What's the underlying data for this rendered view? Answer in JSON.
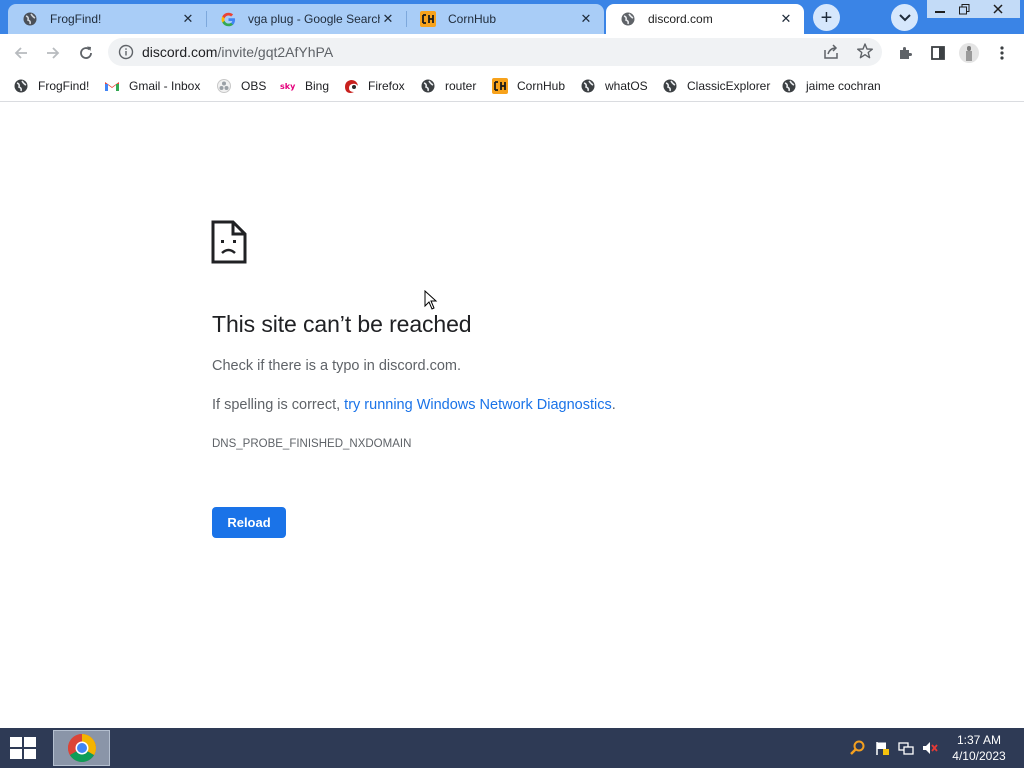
{
  "tabs": [
    {
      "title": "FrogFind!",
      "icon": "globe-icon",
      "active": false
    },
    {
      "title": "vga plug - Google Search",
      "icon": "google-icon",
      "active": false
    },
    {
      "title": "CornHub",
      "icon": "ch-icon",
      "active": false
    },
    {
      "title": "discord.com",
      "icon": "globe-icon",
      "active": true
    }
  ],
  "tab_close_glyph": "✕",
  "new_tab_glyph": "+",
  "address_bar": {
    "host": "discord.com",
    "path": "/invite/gqt2AfYhPA"
  },
  "bookmarks": [
    {
      "label": "FrogFind!",
      "icon": "globe-icon"
    },
    {
      "label": "Gmail - Inbox",
      "icon": "gmail-icon"
    },
    {
      "label": "OBS",
      "icon": "obs-icon"
    },
    {
      "label": "Bing",
      "icon": "bing-icon"
    },
    {
      "label": "Firefox",
      "icon": "firefox-icon"
    },
    {
      "label": "router",
      "icon": "globe-icon"
    },
    {
      "label": "CornHub",
      "icon": "ch-icon"
    },
    {
      "label": "whatOS",
      "icon": "globe-icon"
    },
    {
      "label": "ClassicExplorer",
      "icon": "globe-icon"
    },
    {
      "label": "jaime cochran",
      "icon": "globe-icon"
    }
  ],
  "error_page": {
    "title": "This site can’t be reached",
    "line1": "Check if there is a typo in discord.com.",
    "line2_prefix": "If spelling is correct, ",
    "line2_link": "try running Windows Network Diagnostics",
    "line2_suffix": ".",
    "error_code": "DNS_PROBE_FINISHED_NXDOMAIN",
    "reload_label": "Reload"
  },
  "taskbar": {
    "time": "1:37 AM",
    "date": "4/10/2023"
  },
  "colors": {
    "tab_strip": "#3a84e6",
    "inactive_tab": "#a9cdf7",
    "link": "#1a73e8",
    "reload_button": "#1a73e8",
    "taskbar": "#2e3a55"
  }
}
